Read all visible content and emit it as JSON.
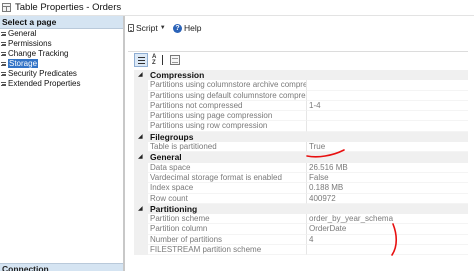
{
  "window": {
    "title": "Table Properties - Orders",
    "app_icon": "table-properties-icon"
  },
  "left_panel": {
    "header": "Select a page",
    "pages": [
      {
        "label": "General",
        "selected": false
      },
      {
        "label": "Permissions",
        "selected": false
      },
      {
        "label": "Change Tracking",
        "selected": false
      },
      {
        "label": "Storage",
        "selected": true
      },
      {
        "label": "Security Predicates",
        "selected": false
      },
      {
        "label": "Extended Properties",
        "selected": false
      }
    ],
    "connection_header": "Connection"
  },
  "toolbar": {
    "script_label": "Script",
    "help_label": "Help",
    "help_glyph": "?",
    "script_icon": "script-icon",
    "help_icon": "help-icon"
  },
  "grid_toolbar": {
    "alpha_top": "A",
    "alpha_bottom": "Z"
  },
  "categories": [
    {
      "name": "Compression",
      "properties": [
        {
          "name": "Partitions using columnstore archive compress",
          "value": ""
        },
        {
          "name": "Partitions using default columnstore compress",
          "value": ""
        },
        {
          "name": "Partitions not compressed",
          "value": "1-4"
        },
        {
          "name": "Partitions using page compression",
          "value": ""
        },
        {
          "name": "Partitions using row compression",
          "value": ""
        }
      ]
    },
    {
      "name": "Filegroups",
      "properties": [
        {
          "name": "Table is partitioned",
          "value": "True"
        }
      ]
    },
    {
      "name": "General",
      "properties": [
        {
          "name": "Data space",
          "value": "26.516 MB"
        },
        {
          "name": "Vardecimal storage format is enabled",
          "value": "False"
        },
        {
          "name": "Index space",
          "value": "0.188 MB"
        },
        {
          "name": "Row count",
          "value": "400972"
        }
      ]
    },
    {
      "name": "Partitioning",
      "properties": [
        {
          "name": "Partition scheme",
          "value": "order_by_year_schema"
        },
        {
          "name": "Partition column",
          "value": "OrderDate"
        },
        {
          "name": "Number of partitions",
          "value": "4"
        },
        {
          "name": "FILESTREAM partition scheme",
          "value": ""
        }
      ]
    }
  ],
  "colors": {
    "selected_page": "#3173c6",
    "annotation_marker": "#e81010",
    "category_background": "#f0f0f0",
    "panel_header": "#d5e4f2"
  }
}
